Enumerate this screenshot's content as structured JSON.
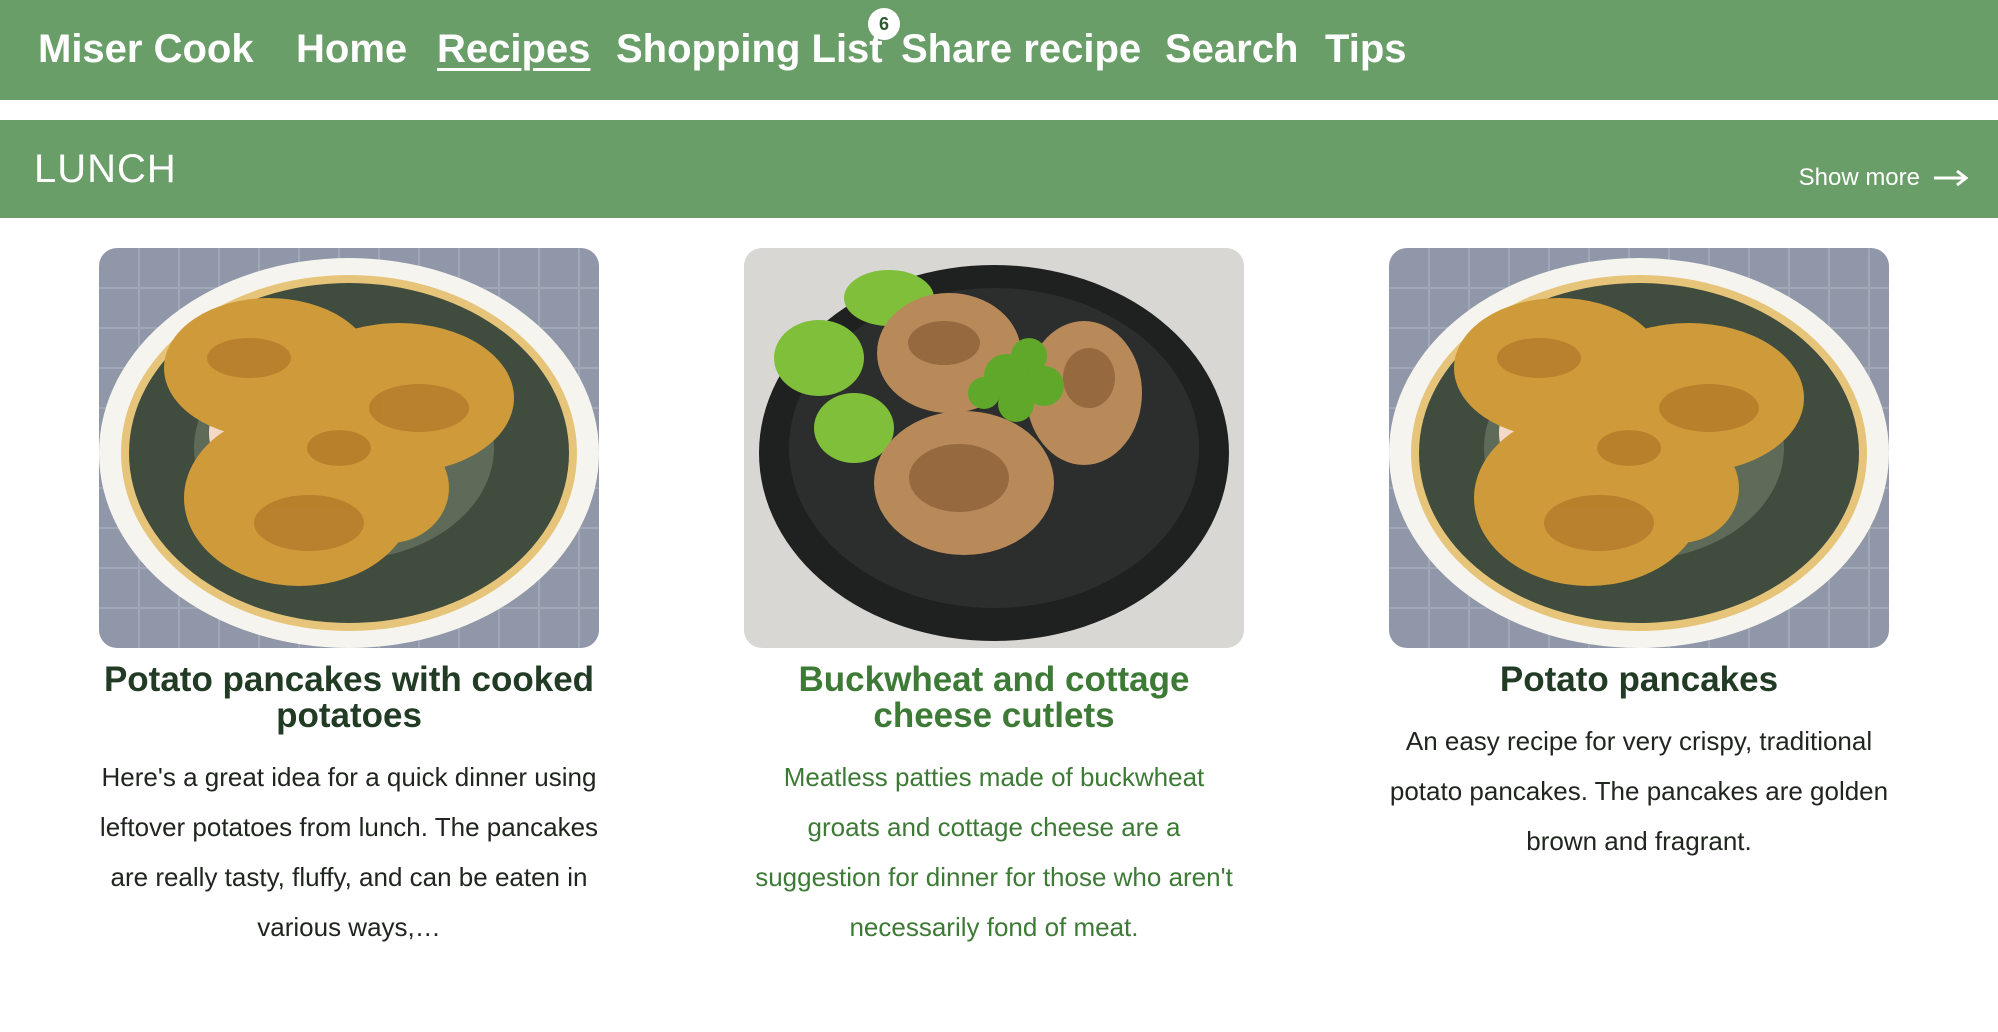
{
  "nav": {
    "brand": "Miser Cook",
    "items": [
      {
        "label": "Home"
      },
      {
        "label": "Recipes",
        "active": true
      },
      {
        "label": "Shopping List",
        "badge": "6"
      },
      {
        "label": "Share recipe"
      },
      {
        "label": "Search"
      },
      {
        "label": "Tips"
      }
    ]
  },
  "section": {
    "title": "LUNCH",
    "show_more": "Show more",
    "arrow_icon": "arrow-right-icon"
  },
  "cards": [
    {
      "title": "Potato pancakes with cooked potatoes",
      "description": "Here's a great idea for a quick dinner using leftover potatoes from lunch. The pancakes are really tasty, fluffy, and can be eaten in various ways,…"
    },
    {
      "title": "Buckwheat and cottage cheese cutlets",
      "description": "Meatless patties made of buckwheat groats and cottage cheese are a suggestion for dinner for those who aren't necessarily fond of meat."
    },
    {
      "title": "Potato pancakes",
      "description": "An easy recipe for very crispy, traditional potato pancakes. The pancakes are golden brown and fragrant."
    }
  ],
  "colors": {
    "brand_green": "#6a9e68",
    "title_dark": "#213b25",
    "featured_green": "#3d7a36"
  }
}
